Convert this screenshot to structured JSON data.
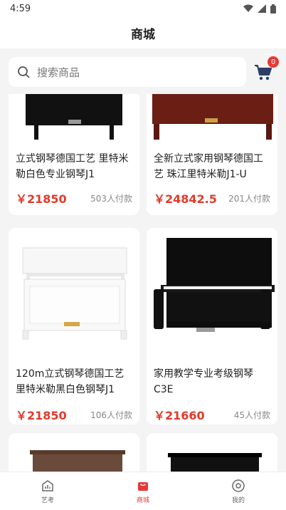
{
  "status": {
    "time": "4:59"
  },
  "header": {
    "title": "商城"
  },
  "search": {
    "placeholder": "搜索商品"
  },
  "cart": {
    "badge": "0"
  },
  "products": [
    {
      "title": "立式钢琴德国工艺 里特米勒白色专业钢琴J1",
      "price": "￥21850",
      "sold": "503人付款"
    },
    {
      "title": "全新立式家用钢琴德国工艺 珠江里特米勒J1-U",
      "price": "￥24842.5",
      "sold": "201人付款"
    },
    {
      "title": "120m立式钢琴德国工艺里特米勒黑白色钢琴J1",
      "price": "￥21850",
      "sold": "106人付款"
    },
    {
      "title": "家用教学专业考级钢琴C3E",
      "price": "￥21660",
      "sold": "45人付款"
    }
  ],
  "tabbar": {
    "items": [
      {
        "label": "艺考",
        "icon": "chart-house-icon"
      },
      {
        "label": "商城",
        "icon": "shopping-bag-icon"
      },
      {
        "label": "我的",
        "icon": "profile-disc-icon"
      }
    ],
    "active_color": "#e53935"
  },
  "colors": {
    "price": "#e03a2b",
    "badge": "#e53935",
    "cart_icon": "#2c3e66"
  }
}
